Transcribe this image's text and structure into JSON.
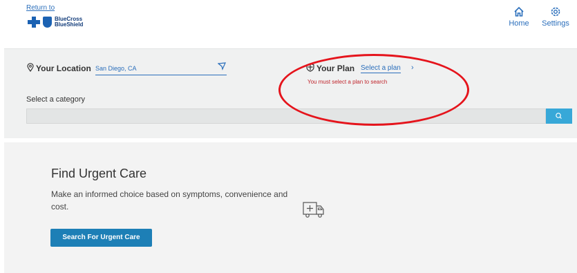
{
  "header": {
    "return_link": "Return to",
    "logo_text": [
      "BlueCross",
      "BlueShield"
    ],
    "nav": [
      {
        "label": "Home",
        "icon": "home-icon"
      },
      {
        "label": "Settings",
        "icon": "gear-icon"
      }
    ]
  },
  "search": {
    "location_label": "Your Location",
    "location_value": "San Diego, CA",
    "plan_label": "Your Plan",
    "plan_select": "Select a plan",
    "plan_error": "You must select a plan to search",
    "category_label": "Select a category",
    "category_placeholder": ""
  },
  "urgent_care": {
    "title": "Find Urgent Care",
    "description": "Make an informed choice based on symptoms, convenience and cost.",
    "button": "Search For Urgent Care"
  },
  "colors": {
    "brand_blue": "#1b62b3",
    "link_blue": "#2a6ebb",
    "button_blue": "#1d7fb6",
    "search_button": "#37a8d8",
    "error_red": "#c0262d",
    "highlight_red": "#e5141c"
  }
}
